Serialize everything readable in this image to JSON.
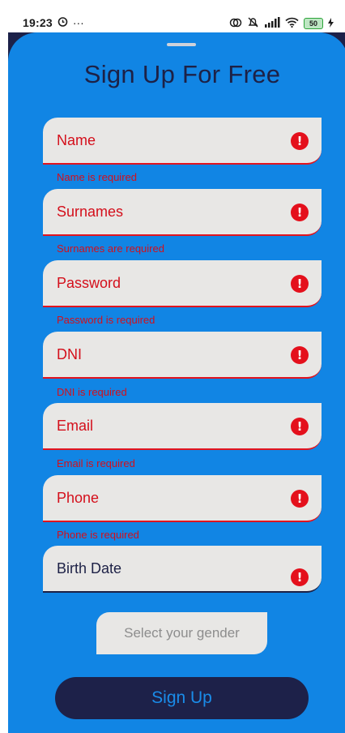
{
  "status_bar": {
    "time": "19:23",
    "dots": "···",
    "battery": "50",
    "icons": [
      "sync-icon",
      "notification-off-icon",
      "signal-icon",
      "wifi-icon",
      "battery-icon",
      "charging-icon"
    ]
  },
  "form": {
    "title": "Sign Up For Free",
    "fields": [
      {
        "label": "Name",
        "error": "Name is required"
      },
      {
        "label": "Surnames",
        "error": "Surnames are required"
      },
      {
        "label": "Password",
        "error": "Password is required"
      },
      {
        "label": "DNI",
        "error": "DNI is required"
      },
      {
        "label": "Email",
        "error": "Email is required"
      },
      {
        "label": "Phone",
        "error": "Phone is required"
      },
      {
        "label": "Birth Date"
      }
    ],
    "gender_placeholder": "Select your gender",
    "submit_label": "Sign Up",
    "error_icon_glyph": "!"
  },
  "colors": {
    "accent": "#1185e4",
    "dark": "#1d2146",
    "error": "#e4101c",
    "field_bg": "#e8e7e5"
  }
}
